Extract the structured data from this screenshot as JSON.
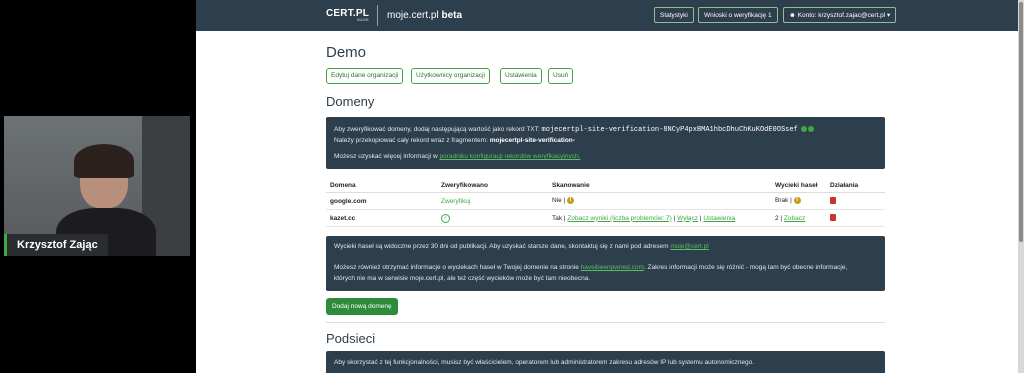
{
  "webcam": {
    "participant_name": "Krzysztof Zając"
  },
  "navbar": {
    "logo_text": "CERT.PL",
    "logo_sub": "NASK",
    "app_title": "moje.cert.pl",
    "app_title_badge": "beta",
    "stats_label": "Statystyki",
    "requests_label": "Wnioski o weryfikację",
    "requests_count": "1",
    "account_label": "Konto: krzysztof.zajac@cert.pl ▾"
  },
  "org": {
    "title": "Demo",
    "buttons": [
      "Edytuj dane organizacji",
      "Użytkownicy organizacji",
      "Ustawienia",
      "Usuń"
    ]
  },
  "domains": {
    "title": "Domeny",
    "verify_info": {
      "line1_prefix": "Aby zweryfikować domeny, dodaj następującą wartość jako rekord TXT:",
      "txt_record": "mojecertpl-site-verification-8NCyP4pxBMA1hbcDhuChKuKOdE0OSsef",
      "line2_prefix": "Należy przekopiować cały rekord wraz z fragmentem:",
      "line2_fragment": "mojecertpl-site-verification-",
      "line3_prefix": "Możesz uzyskać więcej informacji w",
      "line3_link": "poradniku konfiguracji rekordów weryfikacyjnych."
    },
    "table": {
      "headers": [
        "Domena",
        "Zweryfikowano",
        "Skanowanie",
        "Wycieki haseł",
        "Działania"
      ],
      "rows": [
        {
          "domain": "google.com",
          "verified": "Zweryfikuj",
          "scan_status": "Nie |",
          "scan_links": [],
          "leaks": "Brak |",
          "leaks_link": ""
        },
        {
          "domain": "kazet.cc",
          "verified": "",
          "scan_status": "Tak |",
          "scan_links": [
            "Zobacz wyniki (liczba problemów: 7)",
            "Wyłącz",
            "Ustawienia"
          ],
          "leaks": "2 |",
          "leaks_link": "Zobacz"
        }
      ]
    },
    "leaks_info": {
      "line1_prefix": "Wycieki haseł są widoczne przez 30 dni od publikacji. Aby uzyskać starsze dane, skontaktuj się z nami pod adresem",
      "line1_link": "moje@cert.pl",
      "line2_prefix": "Możesz również otrzymać informacje o wyciekach haseł w Twojej domenie na stronie",
      "line2_link": "haveibeenpwned.com",
      "line2_suffix": ". Zakres informacji może się różnić - mogą tam być obecne informacje,",
      "line3": "których nie ma w serwisie moje.cert.pl, ale też część wycieków może być tam nieobecna."
    },
    "add_button": "Dodaj nową domenę"
  },
  "subnets": {
    "title": "Podsieci",
    "info": "Aby skorzystać z tej funkcjonalności, musisz być właścicielem, operatorem lub administratorem zakresu adresów IP lub systemu autonomicznego."
  }
}
